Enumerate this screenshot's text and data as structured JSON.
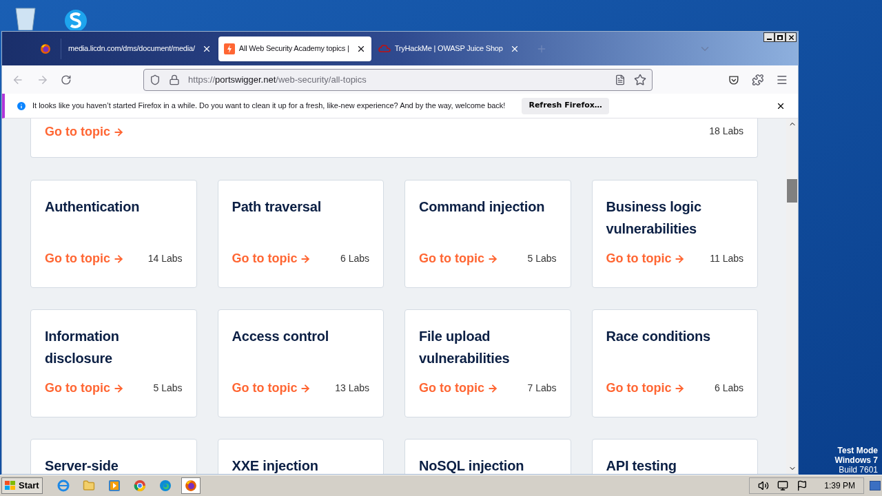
{
  "desktop": {
    "notice": [
      "Test Mode",
      "Windows 7",
      "Build 7601"
    ]
  },
  "browser": {
    "tabs": [
      {
        "title": "media.licdn.com/dms/document/media/",
        "selected": false,
        "kind": "document"
      },
      {
        "title": "All Web Security Academy topics |",
        "selected": true,
        "kind": "portswigger"
      },
      {
        "title": "TryHackMe | OWASP Juice Shop",
        "selected": false,
        "kind": "tryhackme"
      }
    ],
    "url": {
      "scheme": "https://",
      "host": "portswigger.net",
      "path": "/web-security/all-topics"
    },
    "notification": {
      "message": "It looks like you haven’t started Firefox in a while. Do you want to clean it up for a fresh, like-new experience? And by the way, welcome back!",
      "button": "Refresh Firefox…"
    }
  },
  "page": {
    "partial_card": {
      "link": "Go to topic",
      "labs": "18 Labs"
    },
    "topics": [
      {
        "title": "Authentication",
        "link": "Go to topic",
        "labs": "14 Labs"
      },
      {
        "title": "Path traversal",
        "link": "Go to topic",
        "labs": "6 Labs"
      },
      {
        "title": "Command injection",
        "link": "Go to topic",
        "labs": "5 Labs"
      },
      {
        "title": "Business logic vulnerabilities",
        "link": "Go to topic",
        "labs": "11 Labs"
      },
      {
        "title": "Information disclosure",
        "link": "Go to topic",
        "labs": "5 Labs"
      },
      {
        "title": "Access control",
        "link": "Go to topic",
        "labs": "13 Labs"
      },
      {
        "title": "File upload vulnerabilities",
        "link": "Go to topic",
        "labs": "7 Labs"
      },
      {
        "title": "Race conditions",
        "link": "Go to topic",
        "labs": "6 Labs"
      },
      {
        "title": "Server-side"
      },
      {
        "title": "XXE injection"
      },
      {
        "title": "NoSQL injection"
      },
      {
        "title": "API testing"
      }
    ]
  },
  "taskbar": {
    "start": "Start",
    "apps": [
      {
        "kind": "ie",
        "selected": false
      },
      {
        "kind": "explorer",
        "selected": false
      },
      {
        "kind": "media",
        "selected": false
      },
      {
        "kind": "chrome",
        "selected": false
      },
      {
        "kind": "edge",
        "selected": false
      },
      {
        "kind": "firefox",
        "selected": true
      }
    ],
    "clock": "1:39 PM"
  }
}
